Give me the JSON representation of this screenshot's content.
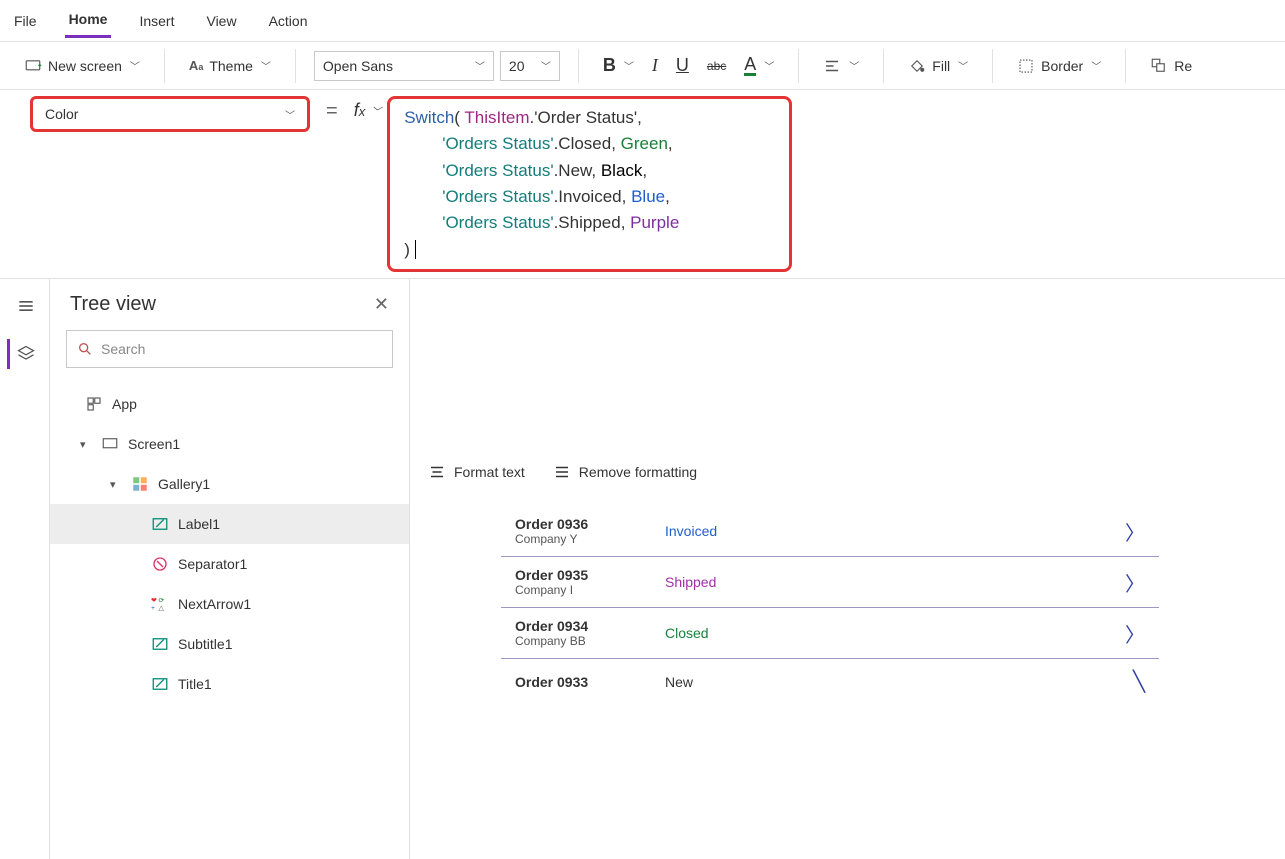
{
  "menu": {
    "file": "File",
    "home": "Home",
    "insert": "Insert",
    "view": "View",
    "action": "Action"
  },
  "ribbon": {
    "new_screen": "New screen",
    "theme": "Theme",
    "font_name": "Open Sans",
    "font_size": "20",
    "fill": "Fill",
    "border": "Border",
    "reorder": "Re"
  },
  "property_dropdown": "Color",
  "formula": {
    "func": "Switch",
    "open": "(",
    "thisitem": " ThisItem",
    "dot_status": ".'Order Status',",
    "line_closed_lit": "'Orders Status'",
    "line_closed_rest": ".Closed, ",
    "col_green": "Green",
    "line_new_lit": "'Orders Status'",
    "line_new_rest": ".New, ",
    "col_black": "Black",
    "line_inv_lit": "'Orders Status'",
    "line_inv_rest": ".Invoiced, ",
    "col_blue": "Blue",
    "line_ship_lit": "'Orders Status'",
    "line_ship_rest": ".Shipped, ",
    "col_purple": "Purple",
    "close": ")"
  },
  "formula_bar": {
    "format_text": "Format text",
    "remove_fmt": "Remove formatting"
  },
  "tree": {
    "title": "Tree view",
    "search_placeholder": "Search",
    "app": "App",
    "screen1": "Screen1",
    "gallery1": "Gallery1",
    "label1": "Label1",
    "separator1": "Separator1",
    "nextarrow1": "NextArrow1",
    "subtitle1": "Subtitle1",
    "title1": "Title1"
  },
  "orders": [
    {
      "order": "Order 0936",
      "company": "Company Y",
      "status_text": "Invoiced",
      "status_class": "invoiced"
    },
    {
      "order": "Order 0935",
      "company": "Company I",
      "status_text": "Shipped",
      "status_class": "shipped"
    },
    {
      "order": "Order 0934",
      "company": "Company BB",
      "status_text": "Closed",
      "status_class": "closed"
    },
    {
      "order": "Order 0933",
      "company": "",
      "status_text": "New",
      "status_class": "new"
    }
  ]
}
